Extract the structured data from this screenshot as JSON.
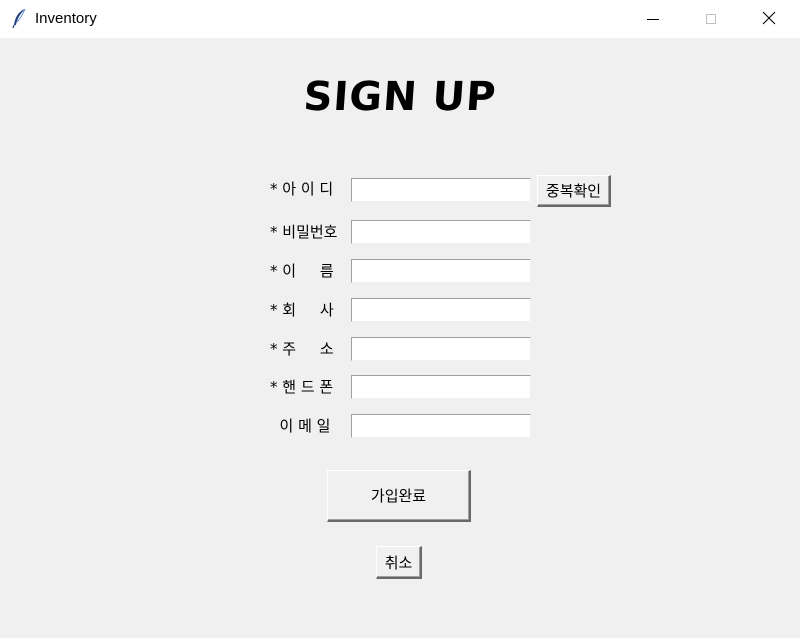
{
  "window": {
    "title": "Inventory",
    "icon": "feather-icon",
    "controls": [
      "minimize-icon",
      "maximize-icon",
      "close-icon"
    ]
  },
  "heading": "SIGN UP",
  "form": {
    "fields": [
      {
        "label": "* 아 이 디",
        "value": ""
      },
      {
        "label": "* 비밀번호",
        "value": ""
      },
      {
        "label": "* 이     름",
        "value": ""
      },
      {
        "label": "* 회     사",
        "value": ""
      },
      {
        "label": "* 주     소",
        "value": ""
      },
      {
        "label": "* 핸 드 폰",
        "value": ""
      },
      {
        "label": "  이 메 일",
        "value": ""
      }
    ],
    "check_duplicate_label": "중복확인",
    "submit_label": "가입완료",
    "cancel_label": "취소"
  }
}
